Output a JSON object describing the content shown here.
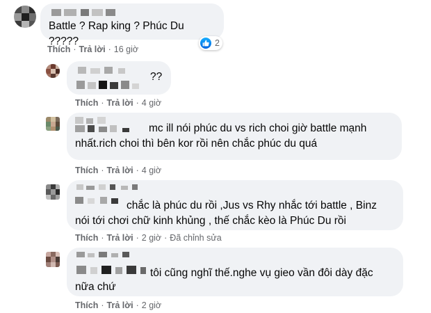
{
  "comments": [
    {
      "text": "Battle ? Rap king ? Phúc Du ?????",
      "like_label": "Thích",
      "reply_label": "Trả lời",
      "time": "16 giờ",
      "reaction_count": "2"
    },
    {
      "text": "??",
      "like_label": "Thích",
      "reply_label": "Trả lời",
      "time": "4 giờ"
    },
    {
      "text_line1": "mc ill nói phúc du vs rich choi giờ battle mạnh",
      "text_line2": "nhất.rich choi thì bên kor rồi nên chắc phúc du quá",
      "like_label": "Thích",
      "reply_label": "Trả lời",
      "time": "4 giờ"
    },
    {
      "text_line1": "chắc là phúc du rồi ,Jus vs Rhy nhắc tới battle , Binz",
      "text_line2": "nói tới chơi chữ kinh khủng , thế chắc kèo là Phúc Du rồi",
      "like_label": "Thích",
      "reply_label": "Trả lời",
      "time": "2 giờ",
      "edited_label": "Đã chỉnh sửa"
    },
    {
      "text_line1": "tôi cũng nghĩ thế.nghe vụ gieo vần đôi dày đặc",
      "text_line2": "nữa chứ",
      "like_label": "Thích",
      "reply_label": "Trả lời",
      "time": "2 giờ"
    }
  ],
  "colors": {
    "bubble": "#f0f2f5",
    "meta_text": "#65676b",
    "like_blue": "#1877f2"
  },
  "icons": [
    "like-reaction-icon"
  ]
}
